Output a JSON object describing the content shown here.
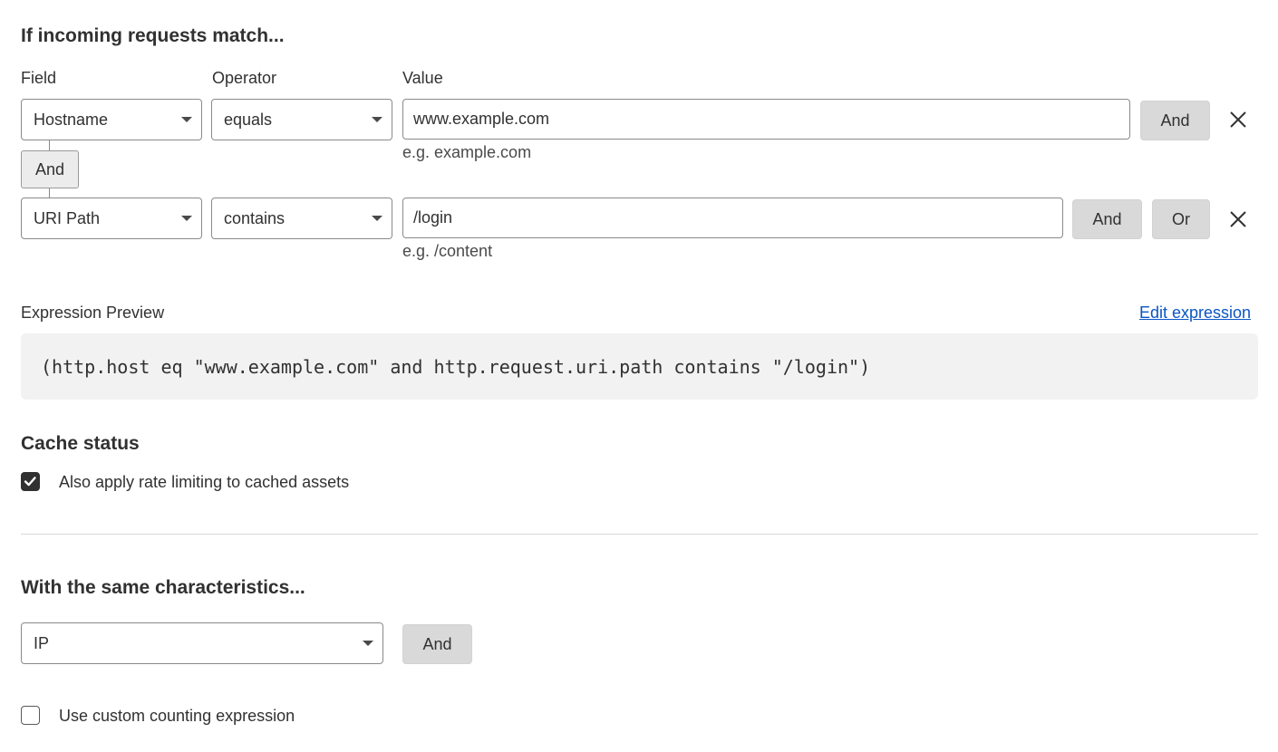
{
  "match_section": {
    "heading": "If incoming requests match...",
    "columns": {
      "field": "Field",
      "operator": "Operator",
      "value": "Value"
    },
    "rows": [
      {
        "field": "Hostname",
        "operator": "equals",
        "value": "www.example.com",
        "hint": "e.g. example.com",
        "and_label": "And"
      },
      {
        "field": "URI Path",
        "operator": "contains",
        "value": "/login",
        "hint": "e.g. /content",
        "and_label": "And",
        "or_label": "Or"
      }
    ],
    "join_label": "And"
  },
  "expression": {
    "label": "Expression Preview",
    "edit_link": "Edit expression",
    "text": "(http.host eq \"www.example.com\" and http.request.uri.path contains \"/login\")"
  },
  "cache_status": {
    "heading": "Cache status",
    "checkbox_label": "Also apply rate limiting to cached assets",
    "checked": true
  },
  "characteristics": {
    "heading": "With the same characteristics...",
    "selected": "IP",
    "and_label": "And",
    "custom_label": "Use custom counting expression",
    "custom_checked": false
  },
  "icons": {
    "close": "close-icon",
    "caret": "chevron-down-icon",
    "check": "check-icon"
  }
}
